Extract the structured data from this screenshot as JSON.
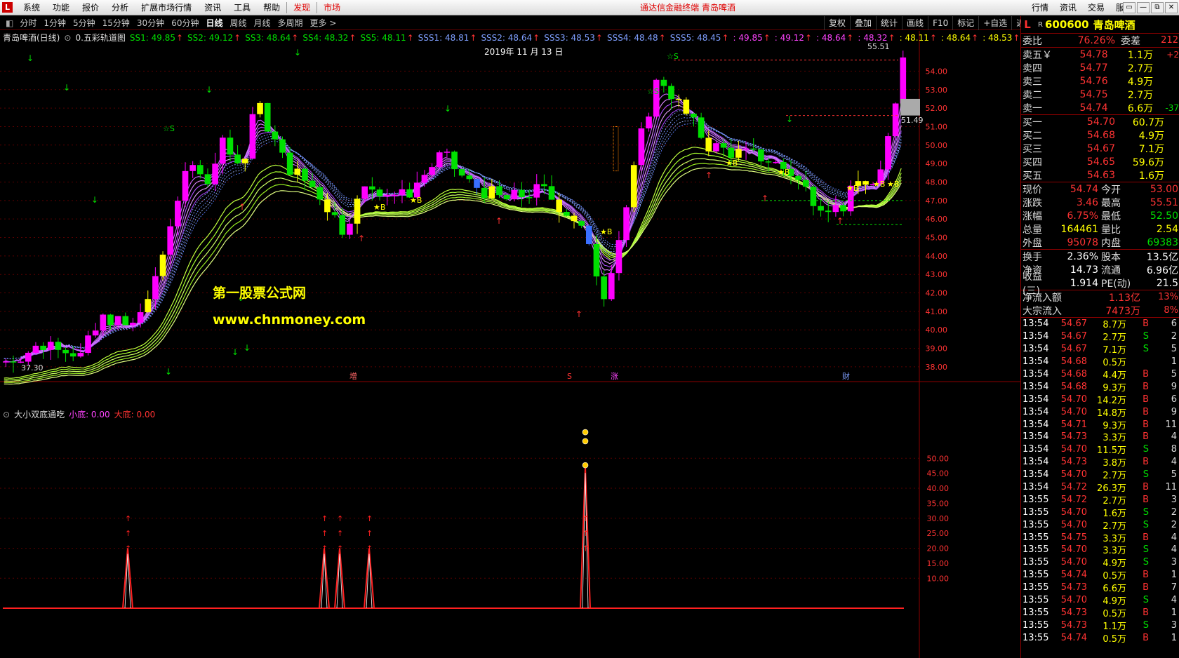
{
  "menubar": {
    "logo": "L",
    "items": [
      "系统",
      "功能",
      "报价",
      "分析",
      "扩展市场行情",
      "资讯",
      "工具",
      "帮助"
    ],
    "red_items": [
      "发现",
      "市场"
    ],
    "title": "通达信金融终端 青岛啤酒",
    "right_items": [
      "行情",
      "资讯",
      "交易",
      "服务"
    ],
    "controls": [
      "▭",
      "—",
      "⧉",
      "✕"
    ]
  },
  "toolbar": {
    "periods": [
      "分时",
      "1分钟",
      "5分钟",
      "15分钟",
      "30分钟",
      "60分钟",
      "日线",
      "周线",
      "月线",
      "多周期",
      "更多 >"
    ],
    "active": "日线",
    "right_buttons": [
      "复权",
      "叠加",
      "统计",
      "画线",
      "F10",
      "标记",
      "+自选",
      "返回"
    ]
  },
  "main": {
    "stock_label": "青岛啤酒(日线)",
    "indicator_name": "0.五彩轨道图",
    "ss": [
      {
        "label": "SS1: 49.85",
        "c": "#00e000"
      },
      {
        "label": "SS2: 49.12",
        "c": "#00e000"
      },
      {
        "label": "SS3: 48.64",
        "c": "#00e000"
      },
      {
        "label": "SS4: 48.32",
        "c": "#00e000"
      },
      {
        "label": "SS5: 48.11",
        "c": "#00e000"
      },
      {
        "label": "SSS1: 48.81",
        "c": "#7f9fff"
      },
      {
        "label": "SSS2: 48.64",
        "c": "#7f9fff"
      },
      {
        "label": "SSS3: 48.53",
        "c": "#7f9fff"
      },
      {
        "label": "SSS4: 48.48",
        "c": "#7f9fff"
      },
      {
        "label": "SSS5: 48.45",
        "c": "#7f9fff"
      },
      {
        "label": ": 49.85",
        "c": "#ff44ff"
      },
      {
        "label": ": 49.12",
        "c": "#ff44ff"
      },
      {
        "label": ": 48.64",
        "c": "#ff44ff"
      },
      {
        "label": ": 48.32",
        "c": "#ff44ff"
      },
      {
        "label": ": 48.11",
        "c": "#ffff00"
      },
      {
        "label": ": 48.64",
        "c": "#ffff00"
      },
      {
        "label": ": 48.53",
        "c": "#ffff00"
      }
    ],
    "date": "2019年 11 月 13 日",
    "watermark": [
      "第一股票公式网",
      "www.chnmoney.com"
    ],
    "high_label": "55.51",
    "low_label": "37.30",
    "last_label": "51.49",
    "price_axis": [
      "54.00",
      "53.00",
      "52.00",
      "51.00",
      "50.00",
      "49.00",
      "48.00",
      "47.00",
      "46.00",
      "45.00",
      "44.00",
      "43.00",
      "42.00",
      "41.00",
      "40.00",
      "39.00",
      "38.00"
    ],
    "events": [
      "增",
      "S",
      "涨",
      "财"
    ]
  },
  "sub": {
    "title": "大小双底通吃",
    "small_label": "小底: 0.00",
    "big_label": "大底: 0.00",
    "axis": [
      "50.00",
      "45.00",
      "40.00",
      "35.00",
      "30.00",
      "25.00",
      "20.00",
      "15.00",
      "10.00"
    ]
  },
  "quote": {
    "header": {
      "market": "L",
      "r": "R",
      "code": "600600",
      "name": "青岛啤酒"
    },
    "weibi": {
      "label": "委比",
      "value": "76.26%",
      "label2": "委差",
      "value2": "212"
    },
    "sell": [
      {
        "label": "卖五￥",
        "price": "54.78",
        "vol": "1.1万",
        "chg": "+2"
      },
      {
        "label": "卖四",
        "price": "54.77",
        "vol": "2.7万",
        "chg": ""
      },
      {
        "label": "卖三",
        "price": "54.76",
        "vol": "4.9万",
        "chg": ""
      },
      {
        "label": "卖二",
        "price": "54.75",
        "vol": "2.7万",
        "chg": ""
      },
      {
        "label": "卖一",
        "price": "54.74",
        "vol": "6.6万",
        "chg": "-37"
      }
    ],
    "buy": [
      {
        "label": "买一",
        "price": "54.70",
        "vol": "60.7万"
      },
      {
        "label": "买二",
        "price": "54.68",
        "vol": "4.9万"
      },
      {
        "label": "买三",
        "price": "54.67",
        "vol": "7.1万"
      },
      {
        "label": "买四",
        "price": "54.65",
        "vol": "59.6万"
      },
      {
        "label": "买五",
        "price": "54.63",
        "vol": "1.6万"
      }
    ],
    "stats1": [
      {
        "l": "现价",
        "v": "54.74",
        "l2": "今开",
        "v2": "53.00"
      },
      {
        "l": "涨跌",
        "v": "3.46",
        "l2": "最高",
        "v2": "55.51"
      },
      {
        "l": "涨幅",
        "v": "6.75%",
        "l2": "最低",
        "v2": "52.50"
      },
      {
        "l": "总量",
        "v": "164461",
        "l2": "量比",
        "v2": "2.54"
      },
      {
        "l": "外盘",
        "v": "95078",
        "l2": "内盘",
        "v2": "69383"
      }
    ],
    "stats2": [
      {
        "l": "换手",
        "v": "2.36%",
        "l2": "股本",
        "v2": "13.5亿"
      },
      {
        "l": "净资",
        "v": "14.73",
        "l2": "流通",
        "v2": "6.96亿"
      },
      {
        "l": "收益(三)",
        "v": "1.914",
        "l2": "PE(动)",
        "v2": "21.5"
      }
    ],
    "flow": [
      {
        "l": "净流入额",
        "v": "1.13亿",
        "p": "13%"
      },
      {
        "l": "大宗流入",
        "v": "7473万",
        "p": "8%"
      }
    ],
    "ticks": [
      {
        "t": "13:54",
        "p": "54.67",
        "q": "8.7万",
        "f": "B",
        "n": "6"
      },
      {
        "t": "13:54",
        "p": "54.67",
        "q": "2.7万",
        "f": "S",
        "n": "2"
      },
      {
        "t": "13:54",
        "p": "54.67",
        "q": "7.1万",
        "f": "S",
        "n": "5"
      },
      {
        "t": "13:54",
        "p": "54.68",
        "q": "0.5万",
        "f": "",
        "n": "1"
      },
      {
        "t": "13:54",
        "p": "54.68",
        "q": "4.4万",
        "f": "B",
        "n": "5"
      },
      {
        "t": "13:54",
        "p": "54.68",
        "q": "9.3万",
        "f": "B",
        "n": "9"
      },
      {
        "t": "13:54",
        "p": "54.70",
        "q": "14.2万",
        "f": "B",
        "n": "6"
      },
      {
        "t": "13:54",
        "p": "54.70",
        "q": "14.8万",
        "f": "B",
        "n": "9"
      },
      {
        "t": "13:54",
        "p": "54.71",
        "q": "9.3万",
        "f": "B",
        "n": "11"
      },
      {
        "t": "13:54",
        "p": "54.73",
        "q": "3.3万",
        "f": "B",
        "n": "4"
      },
      {
        "t": "13:54",
        "p": "54.70",
        "q": "11.5万",
        "f": "S",
        "n": "8"
      },
      {
        "t": "13:54",
        "p": "54.73",
        "q": "3.8万",
        "f": "B",
        "n": "4"
      },
      {
        "t": "13:54",
        "p": "54.70",
        "q": "2.7万",
        "f": "S",
        "n": "5"
      },
      {
        "t": "13:54",
        "p": "54.72",
        "q": "26.3万",
        "f": "B",
        "n": "11"
      },
      {
        "t": "13:55",
        "p": "54.72",
        "q": "2.7万",
        "f": "B",
        "n": "3"
      },
      {
        "t": "13:55",
        "p": "54.70",
        "q": "1.6万",
        "f": "S",
        "n": "2"
      },
      {
        "t": "13:55",
        "p": "54.70",
        "q": "2.7万",
        "f": "S",
        "n": "2"
      },
      {
        "t": "13:55",
        "p": "54.75",
        "q": "3.3万",
        "f": "B",
        "n": "4"
      },
      {
        "t": "13:55",
        "p": "54.70",
        "q": "3.3万",
        "f": "S",
        "n": "4"
      },
      {
        "t": "13:55",
        "p": "54.70",
        "q": "4.9万",
        "f": "S",
        "n": "3"
      },
      {
        "t": "13:55",
        "p": "54.74",
        "q": "0.5万",
        "f": "B",
        "n": "1"
      },
      {
        "t": "13:55",
        "p": "54.73",
        "q": "6.6万",
        "f": "B",
        "n": "7"
      },
      {
        "t": "13:55",
        "p": "54.70",
        "q": "4.9万",
        "f": "S",
        "n": "4"
      },
      {
        "t": "13:55",
        "p": "54.73",
        "q": "0.5万",
        "f": "B",
        "n": "1"
      },
      {
        "t": "13:55",
        "p": "54.73",
        "q": "1.1万",
        "f": "S",
        "n": "3"
      },
      {
        "t": "13:55",
        "p": "54.74",
        "q": "0.5万",
        "f": "B",
        "n": "1"
      }
    ]
  },
  "colors": {
    "up": "#ff00ff",
    "down": "#00e000",
    "yellow": "#ffff00",
    "blue": "#3a6fff",
    "orange": "#ff8000",
    "grid": "#5a0000"
  }
}
